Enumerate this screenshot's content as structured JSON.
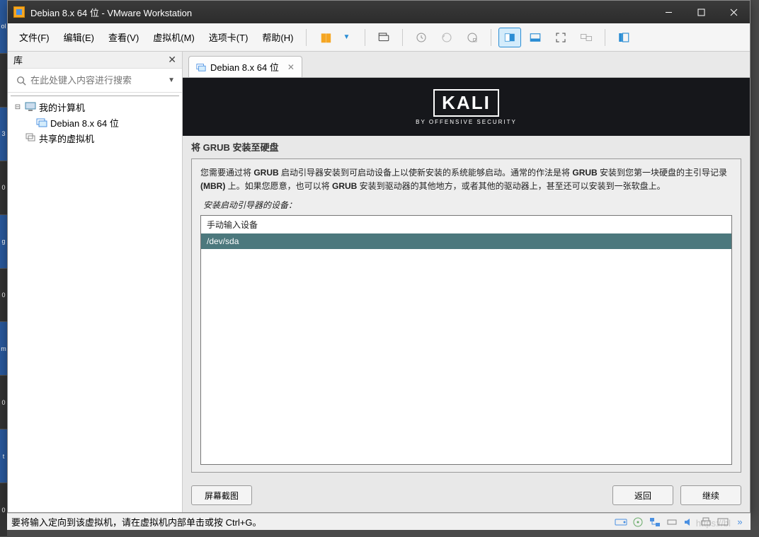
{
  "window": {
    "title": "Debian 8.x 64 位 - VMware Workstation"
  },
  "menu": {
    "file": "文件(F)",
    "edit": "编辑(E)",
    "view": "查看(V)",
    "vm": "虚拟机(M)",
    "tabs": "选项卡(T)",
    "help": "帮助(H)"
  },
  "sidebar": {
    "title": "库",
    "search_placeholder": "在此处键入内容进行搜索",
    "nodes": {
      "my_computer": "我的计算机",
      "vm_debian": "Debian 8.x 64 位",
      "shared_vms": "共享的虚拟机"
    }
  },
  "tab": {
    "label": "Debian 8.x 64 位"
  },
  "kali": {
    "logo": "KALI",
    "subtitle": "BY OFFENSIVE SECURITY"
  },
  "installer": {
    "title": "将 GRUB 安装至硬盘",
    "desc_1a": "您需要通过将 ",
    "desc_1b": "GRUB",
    "desc_1c": " 启动引导器安装到可启动设备上以使新安装的系统能够启动。通常的作法是将 ",
    "desc_1d": "GRUB",
    "desc_1e": " 安装到您第一块硬盘的主引导记录 ",
    "desc_2a": "(MBR)",
    "desc_2b": " 上。如果您愿意，也可以将 ",
    "desc_2c": "GRUB",
    "desc_2d": " 安装到驱动器的其他地方，或者其他的驱动器上，甚至还可以安装到一张软盘上。",
    "subtitle": "安装启动引导器的设备：",
    "option_manual": "手动输入设备",
    "option_sda": "/dev/sda",
    "btn_screenshot": "屏幕截图",
    "btn_back": "返回",
    "btn_continue": "继续"
  },
  "status": {
    "text": "要将输入定向到该虚拟机，请在虚拟机内部单击或按 Ctrl+G。"
  },
  "watermark": "https://bl"
}
